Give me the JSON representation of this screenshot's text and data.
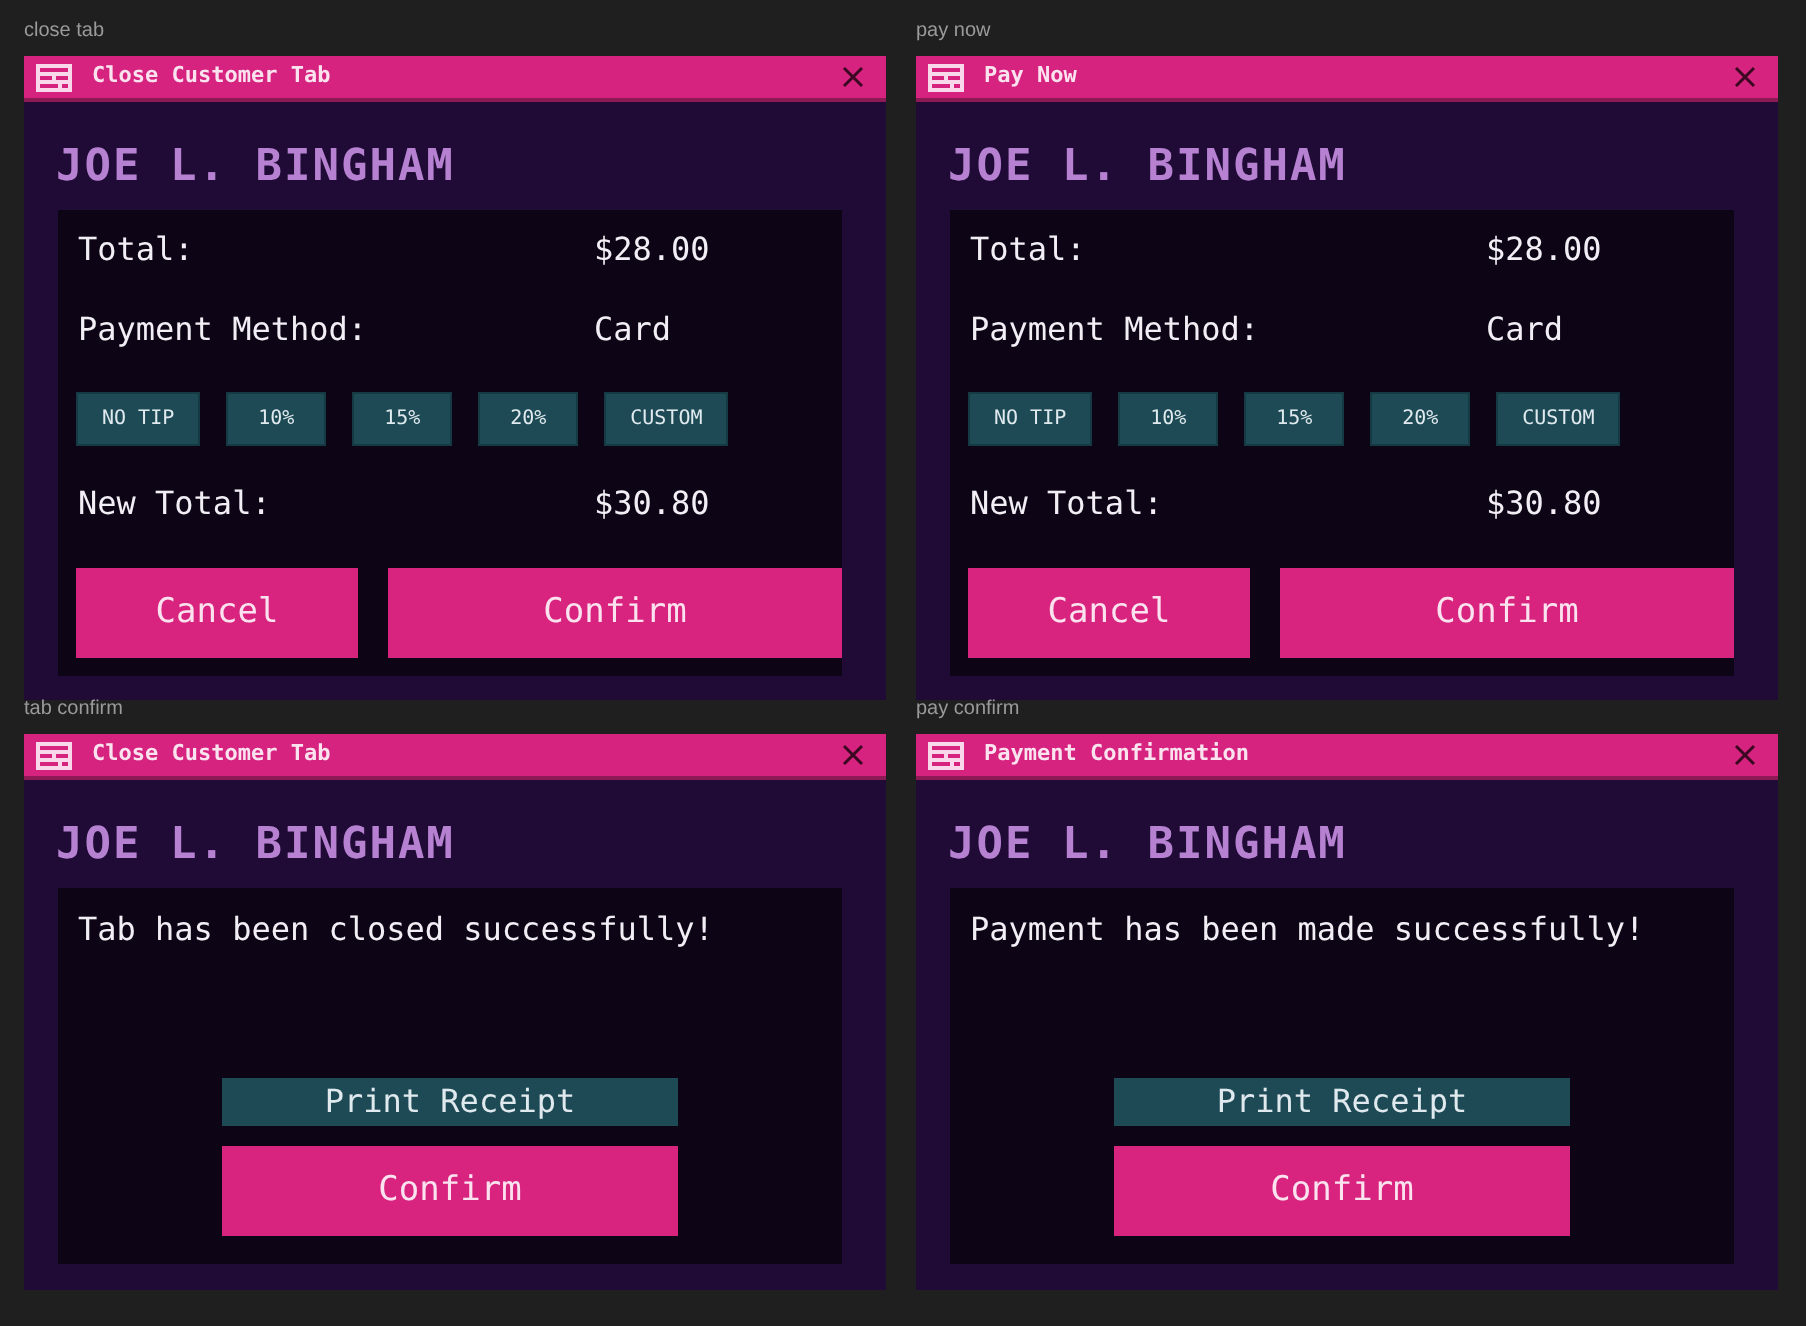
{
  "frames": [
    {
      "label": "close tab",
      "kind": "payment",
      "title": "Close Customer Tab",
      "customer": "JOE L. BINGHAM",
      "total_label": "Total:",
      "total": "$28.00",
      "method_label": "Payment Method:",
      "method": "Card",
      "tips": [
        "NO TIP",
        "10%",
        "15%",
        "20%",
        "CUSTOM"
      ],
      "new_total_label": "New Total:",
      "new_total": "$30.80",
      "cancel": "Cancel",
      "confirm": "Confirm"
    },
    {
      "label": "pay now",
      "kind": "payment",
      "title": "Pay Now",
      "customer": "JOE L. BINGHAM",
      "total_label": "Total:",
      "total": "$28.00",
      "method_label": "Payment Method:",
      "method": "Card",
      "tips": [
        "NO TIP",
        "10%",
        "15%",
        "20%",
        "CUSTOM"
      ],
      "new_total_label": "New Total:",
      "new_total": "$30.80",
      "cancel": "Cancel",
      "confirm": "Confirm"
    },
    {
      "label": "tab confirm",
      "kind": "confirmation",
      "title": "Close Customer Tab",
      "customer": "JOE L. BINGHAM",
      "message": "Tab has been closed successfully!",
      "print": "Print Receipt",
      "confirm": "Confirm"
    },
    {
      "label": "pay confirm",
      "kind": "confirmation",
      "title": "Payment Confirmation",
      "customer": "JOE L. BINGHAM",
      "message": "Payment has been made successfully!",
      "print": "Print Receipt",
      "confirm": "Confirm"
    }
  ]
}
